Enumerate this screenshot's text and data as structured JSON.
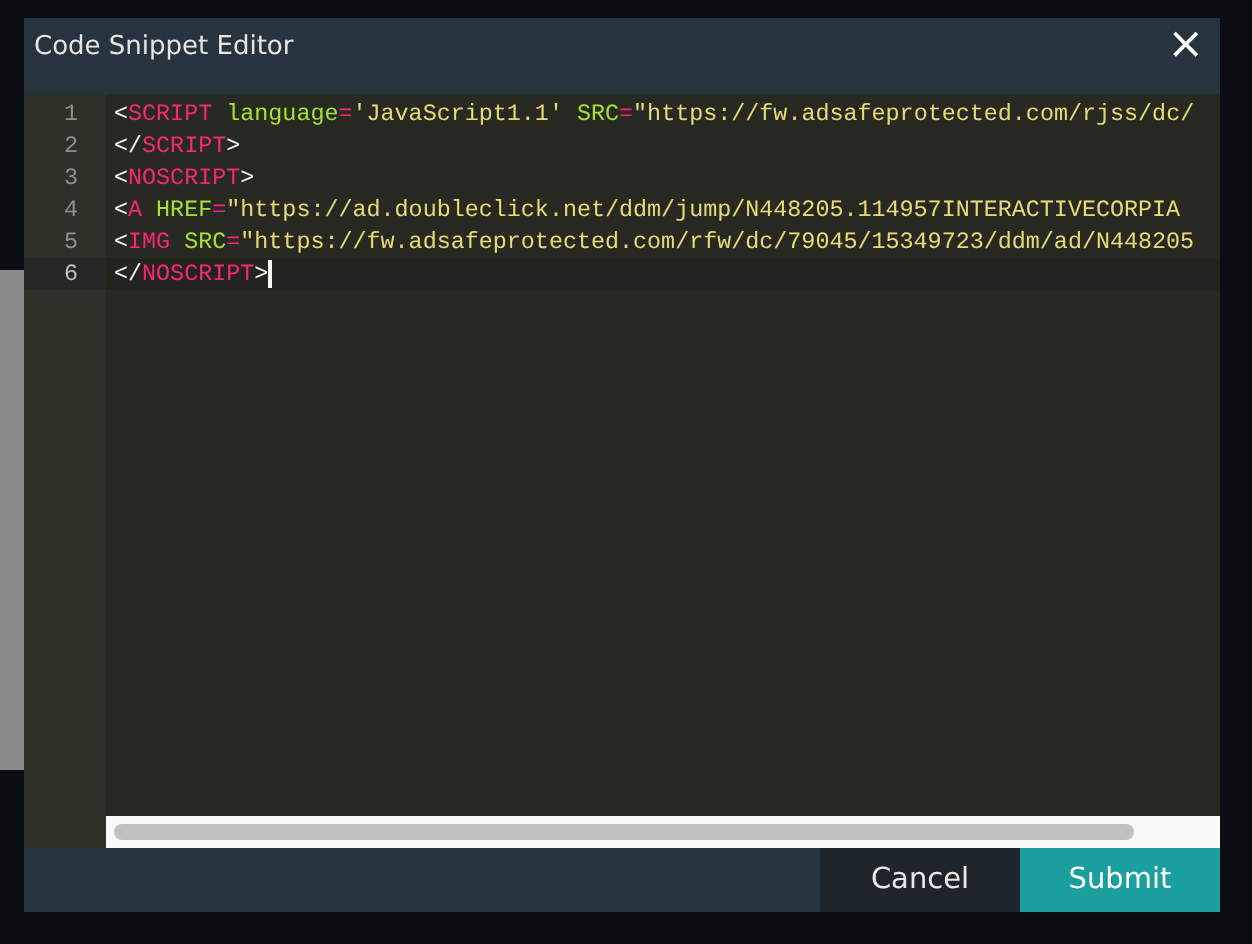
{
  "dialog": {
    "title": "Code Snippet Editor",
    "close": "×"
  },
  "editor": {
    "lines": [
      {
        "number": "1",
        "active": false,
        "tokens": [
          {
            "kind": "punct",
            "text": "<"
          },
          {
            "kind": "tag",
            "text": "SCRIPT"
          },
          {
            "kind": "attr",
            "text": " language"
          },
          {
            "kind": "op",
            "text": "="
          },
          {
            "kind": "string",
            "text": "'JavaScript1.1'"
          },
          {
            "kind": "attr",
            "text": " SRC"
          },
          {
            "kind": "op",
            "text": "="
          },
          {
            "kind": "string",
            "text": "\"https://fw.adsafeprotected.com/rjss/dc/"
          }
        ]
      },
      {
        "number": "2",
        "active": false,
        "tokens": [
          {
            "kind": "punct",
            "text": "</"
          },
          {
            "kind": "tag",
            "text": "SCRIPT"
          },
          {
            "kind": "punct",
            "text": ">"
          }
        ]
      },
      {
        "number": "3",
        "active": false,
        "tokens": [
          {
            "kind": "punct",
            "text": "<"
          },
          {
            "kind": "tag",
            "text": "NOSCRIPT"
          },
          {
            "kind": "punct",
            "text": ">"
          }
        ]
      },
      {
        "number": "4",
        "active": false,
        "tokens": [
          {
            "kind": "punct",
            "text": "<"
          },
          {
            "kind": "tag",
            "text": "A"
          },
          {
            "kind": "attr",
            "text": " HREF"
          },
          {
            "kind": "op",
            "text": "="
          },
          {
            "kind": "string",
            "text": "\"https://ad.doubleclick.net/ddm/jump/N448205.114957INTERACTIVECORPIA"
          }
        ]
      },
      {
        "number": "5",
        "active": false,
        "tokens": [
          {
            "kind": "punct",
            "text": "<"
          },
          {
            "kind": "tag",
            "text": "IMG"
          },
          {
            "kind": "attr",
            "text": " SRC"
          },
          {
            "kind": "op",
            "text": "="
          },
          {
            "kind": "string",
            "text": "\"https://fw.adsafeprotected.com/rfw/dc/79045/15349723/ddm/ad/N448205"
          }
        ]
      },
      {
        "number": "6",
        "active": true,
        "tokens": [
          {
            "kind": "punct",
            "text": "</"
          },
          {
            "kind": "tag",
            "text": "NOSCRIPT"
          },
          {
            "kind": "punct",
            "text": ">"
          }
        ]
      }
    ]
  },
  "buttons": [
    {
      "kind": "secondary",
      "label": "Cancel"
    },
    {
      "kind": "primary",
      "label": "Submit"
    }
  ]
}
